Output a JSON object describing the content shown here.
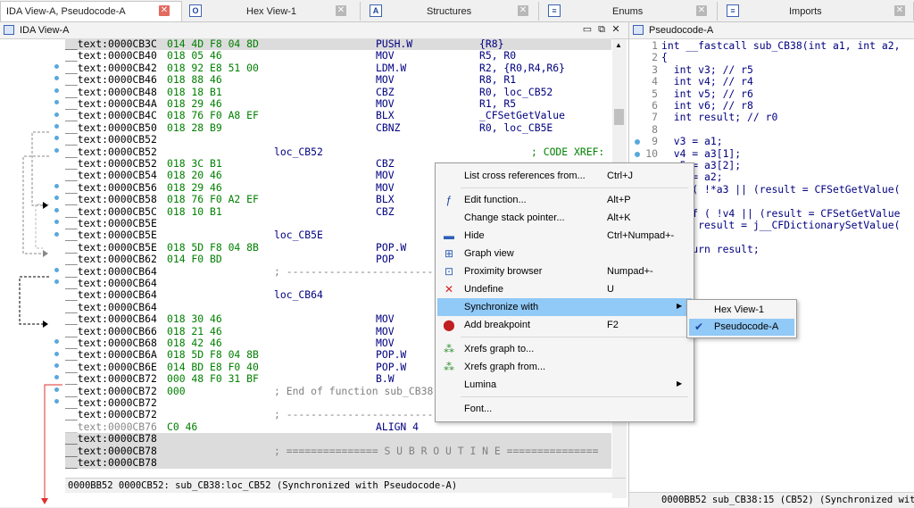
{
  "tabs": [
    {
      "label": "IDA View-A, Pseudocode-A",
      "icon": "listing-icon",
      "active": true
    },
    {
      "label": "Hex View-1",
      "icon": "hex-icon"
    },
    {
      "label": "Structures",
      "icon": "structures-icon"
    },
    {
      "label": "Enums",
      "icon": "enums-icon"
    },
    {
      "label": "Imports",
      "icon": "imports-icon"
    }
  ],
  "left_pane": {
    "title": "IDA View-A",
    "status": "0000BB52 0000CB52: sub_CB38:loc_CB52 (Synchronized with Pseudocode-A)"
  },
  "disasm": [
    {
      "addr": "__text:0000CB3C",
      "bytes": "014 4D F8 04 8D",
      "label": "",
      "mn": "PUSH.W",
      "op": "{R8}",
      "sel": true
    },
    {
      "addr": "__text:0000CB40",
      "bytes": "018 05 46",
      "label": "",
      "mn": "MOV",
      "op": "R5, R0"
    },
    {
      "addr": "__text:0000CB42",
      "bytes": "018 92 E8 51 00",
      "label": "",
      "mn": "LDM.W",
      "op": "R2, {R0,R4,R6}"
    },
    {
      "addr": "__text:0000CB46",
      "bytes": "018 88 46",
      "label": "",
      "mn": "MOV",
      "op": "R8, R1"
    },
    {
      "addr": "__text:0000CB48",
      "bytes": "018 18 B1",
      "label": "",
      "mn": "CBZ",
      "op": "R0, loc_CB52"
    },
    {
      "addr": "__text:0000CB4A",
      "bytes": "018 29 46",
      "label": "",
      "mn": "MOV",
      "op": "R1, R5"
    },
    {
      "addr": "__text:0000CB4C",
      "bytes": "018 76 F0 A8 EF",
      "label": "",
      "mn": "BLX",
      "op": "_CFSetGetValue"
    },
    {
      "addr": "__text:0000CB50",
      "bytes": "018 28 B9",
      "label": "",
      "mn": "CBNZ",
      "op": "R0, loc_CB5E"
    },
    {
      "addr": "__text:0000CB52",
      "bytes": "",
      "label": "",
      "mn": "",
      "op": ""
    },
    {
      "addr": "__text:0000CB52",
      "bytes": "",
      "label": "loc_CB52",
      "mn": "",
      "op": "",
      "rcomment": "; CODE XREF:"
    },
    {
      "addr": "__text:0000CB52",
      "bytes": "018 3C B1",
      "label": "",
      "mn": "CBZ",
      "op": ""
    },
    {
      "addr": "__text:0000CB54",
      "bytes": "018 20 46",
      "label": "",
      "mn": "MOV",
      "op": ""
    },
    {
      "addr": "__text:0000CB56",
      "bytes": "018 29 46",
      "label": "",
      "mn": "MOV",
      "op": ""
    },
    {
      "addr": "__text:0000CB58",
      "bytes": "018 76 F0 A2 EF",
      "label": "",
      "mn": "BLX",
      "op": ""
    },
    {
      "addr": "__text:0000CB5C",
      "bytes": "018 10 B1",
      "label": "",
      "mn": "CBZ",
      "op": ""
    },
    {
      "addr": "__text:0000CB5E",
      "bytes": "",
      "label": "",
      "mn": "",
      "op": ""
    },
    {
      "addr": "__text:0000CB5E",
      "bytes": "",
      "label": "loc_CB5E",
      "mn": "",
      "op": ""
    },
    {
      "addr": "__text:0000CB5E",
      "bytes": "018 5D F8 04 8B",
      "label": "",
      "mn": "POP.W",
      "op": ""
    },
    {
      "addr": "__text:0000CB62",
      "bytes": "014 F0 BD",
      "label": "",
      "mn": "POP",
      "op": ""
    },
    {
      "addr": "__text:0000CB64",
      "bytes": "",
      "label": "",
      "mn": "",
      "op": "",
      "comment": "; ------------------------------"
    },
    {
      "addr": "__text:0000CB64",
      "bytes": "",
      "label": "",
      "mn": "",
      "op": ""
    },
    {
      "addr": "__text:0000CB64",
      "bytes": "",
      "label": "loc_CB64",
      "mn": "",
      "op": ""
    },
    {
      "addr": "__text:0000CB64",
      "bytes": "",
      "label": "",
      "mn": "",
      "op": ""
    },
    {
      "addr": "__text:0000CB64",
      "bytes": "018 30 46",
      "label": "",
      "mn": "MOV",
      "op": ""
    },
    {
      "addr": "__text:0000CB66",
      "bytes": "018 21 46",
      "label": "",
      "mn": "MOV",
      "op": ""
    },
    {
      "addr": "__text:0000CB68",
      "bytes": "018 42 46",
      "label": "",
      "mn": "MOV",
      "op": ""
    },
    {
      "addr": "__text:0000CB6A",
      "bytes": "018 5D F8 04 8B",
      "label": "",
      "mn": "POP.W",
      "op": ""
    },
    {
      "addr": "__text:0000CB6E",
      "bytes": "014 BD E8 F0 40",
      "label": "",
      "mn": "POP.W",
      "op": ""
    },
    {
      "addr": "__text:0000CB72",
      "bytes": "000 48 F0 31 BF",
      "label": "",
      "mn": "B.W",
      "op": ""
    },
    {
      "addr": "__text:0000CB72",
      "bytes": "000",
      "label": "",
      "mn": "",
      "op": "",
      "comment": "; End of function sub_CB38"
    },
    {
      "addr": "__text:0000CB72",
      "bytes": "",
      "label": "",
      "mn": "",
      "op": ""
    },
    {
      "addr": "__text:0000CB72",
      "bytes": "",
      "label": "",
      "mn": "",
      "op": "",
      "comment": "; ------------------------------------------------"
    },
    {
      "addr": "__text:0000CB76",
      "bytes": "C0 46",
      "label": "",
      "mn": "ALIGN 4",
      "op": "",
      "grey": true
    },
    {
      "addr": "__text:0000CB78",
      "bytes": "",
      "label": "",
      "mn": "",
      "op": "",
      "sel": true
    },
    {
      "addr": "__text:0000CB78",
      "bytes": "",
      "label": "",
      "mn": "",
      "op": "",
      "comment": "; =============== S U B R O U T I N E ===============",
      "sel": true
    },
    {
      "addr": "__text:0000CB78",
      "bytes": "",
      "label": "",
      "mn": "",
      "op": "",
      "sel": true
    }
  ],
  "right_pane": {
    "title": "Pseudocode-A",
    "status": "0000BB52 sub_CB38:15 (CB52) (Synchronized with"
  },
  "pseudocode": [
    {
      "no": "1",
      "text": "int __fastcall sub_CB38(int a1, int a2,"
    },
    {
      "no": "2",
      "text": "{"
    },
    {
      "no": "3",
      "text": "  int v3; // r5"
    },
    {
      "no": "4",
      "text": "  int v4; // r4"
    },
    {
      "no": "5",
      "text": "  int v5; // r6"
    },
    {
      "no": "6",
      "text": "  int v6; // r8"
    },
    {
      "no": "7",
      "text": "  int result; // r0"
    },
    {
      "no": "8",
      "text": ""
    },
    {
      "no": "9",
      "text": "  v3 = a1;",
      "dot": true
    },
    {
      "no": "10",
      "text": "  v4 = a3[1];",
      "dot": true
    },
    {
      "no": "",
      "text": "  v5 = a3[2];"
    },
    {
      "no": "",
      "text": "  v6 = a2;"
    },
    {
      "no": "",
      "text": "  if ( !*a3 || (result = CFSetGetValue("
    },
    {
      "no": "",
      "text": ""
    },
    {
      "no": "",
      "text": "    if ( !v4 || (result = CFSetGetValue"
    },
    {
      "no": "",
      "text": "      result = j__CFDictionarySetValue("
    },
    {
      "no": "",
      "text": ""
    },
    {
      "no": "",
      "text": "  return result;"
    }
  ],
  "context_menu": {
    "items": [
      {
        "label": "List cross references from...",
        "shortcut": "Ctrl+J",
        "icon": ""
      },
      {
        "sep": true
      },
      {
        "label": "Edit function...",
        "shortcut": "Alt+P",
        "icon": "function-icon"
      },
      {
        "label": "Change stack pointer...",
        "shortcut": "Alt+K",
        "icon": ""
      },
      {
        "label": "Hide",
        "shortcut": "Ctrl+Numpad+-",
        "icon": "hide-icon"
      },
      {
        "label": "Graph view",
        "shortcut": "",
        "icon": "graph-view-icon"
      },
      {
        "label": "Proximity browser",
        "shortcut": "Numpad+-",
        "icon": "proximity-browser-icon"
      },
      {
        "label": "Undefine",
        "shortcut": "U",
        "icon": "undefine-icon"
      },
      {
        "label": "Synchronize with",
        "shortcut": "",
        "icon": "",
        "submenu": true,
        "highlight": true
      },
      {
        "label": "Add breakpoint",
        "shortcut": "F2",
        "icon": "breakpoint-icon"
      },
      {
        "sep": true
      },
      {
        "label": "Xrefs graph to...",
        "shortcut": "",
        "icon": "xrefs-to-icon"
      },
      {
        "label": "Xrefs graph from...",
        "shortcut": "",
        "icon": "xrefs-from-icon"
      },
      {
        "label": "Lumina",
        "shortcut": "",
        "icon": "",
        "submenu": true
      },
      {
        "sep": true
      },
      {
        "label": "Font...",
        "shortcut": "",
        "icon": ""
      }
    ]
  },
  "submenu": {
    "items": [
      {
        "label": "Hex View-1",
        "checked": false
      },
      {
        "label": "Pseudocode-A",
        "checked": true
      }
    ]
  },
  "colors": {
    "accent": "#91c9f7",
    "address": "#000000",
    "bytes": "#008000",
    "code": "#000080",
    "breakpoint_dot": "#59a8dc",
    "jump_arrow": "#e03030"
  }
}
